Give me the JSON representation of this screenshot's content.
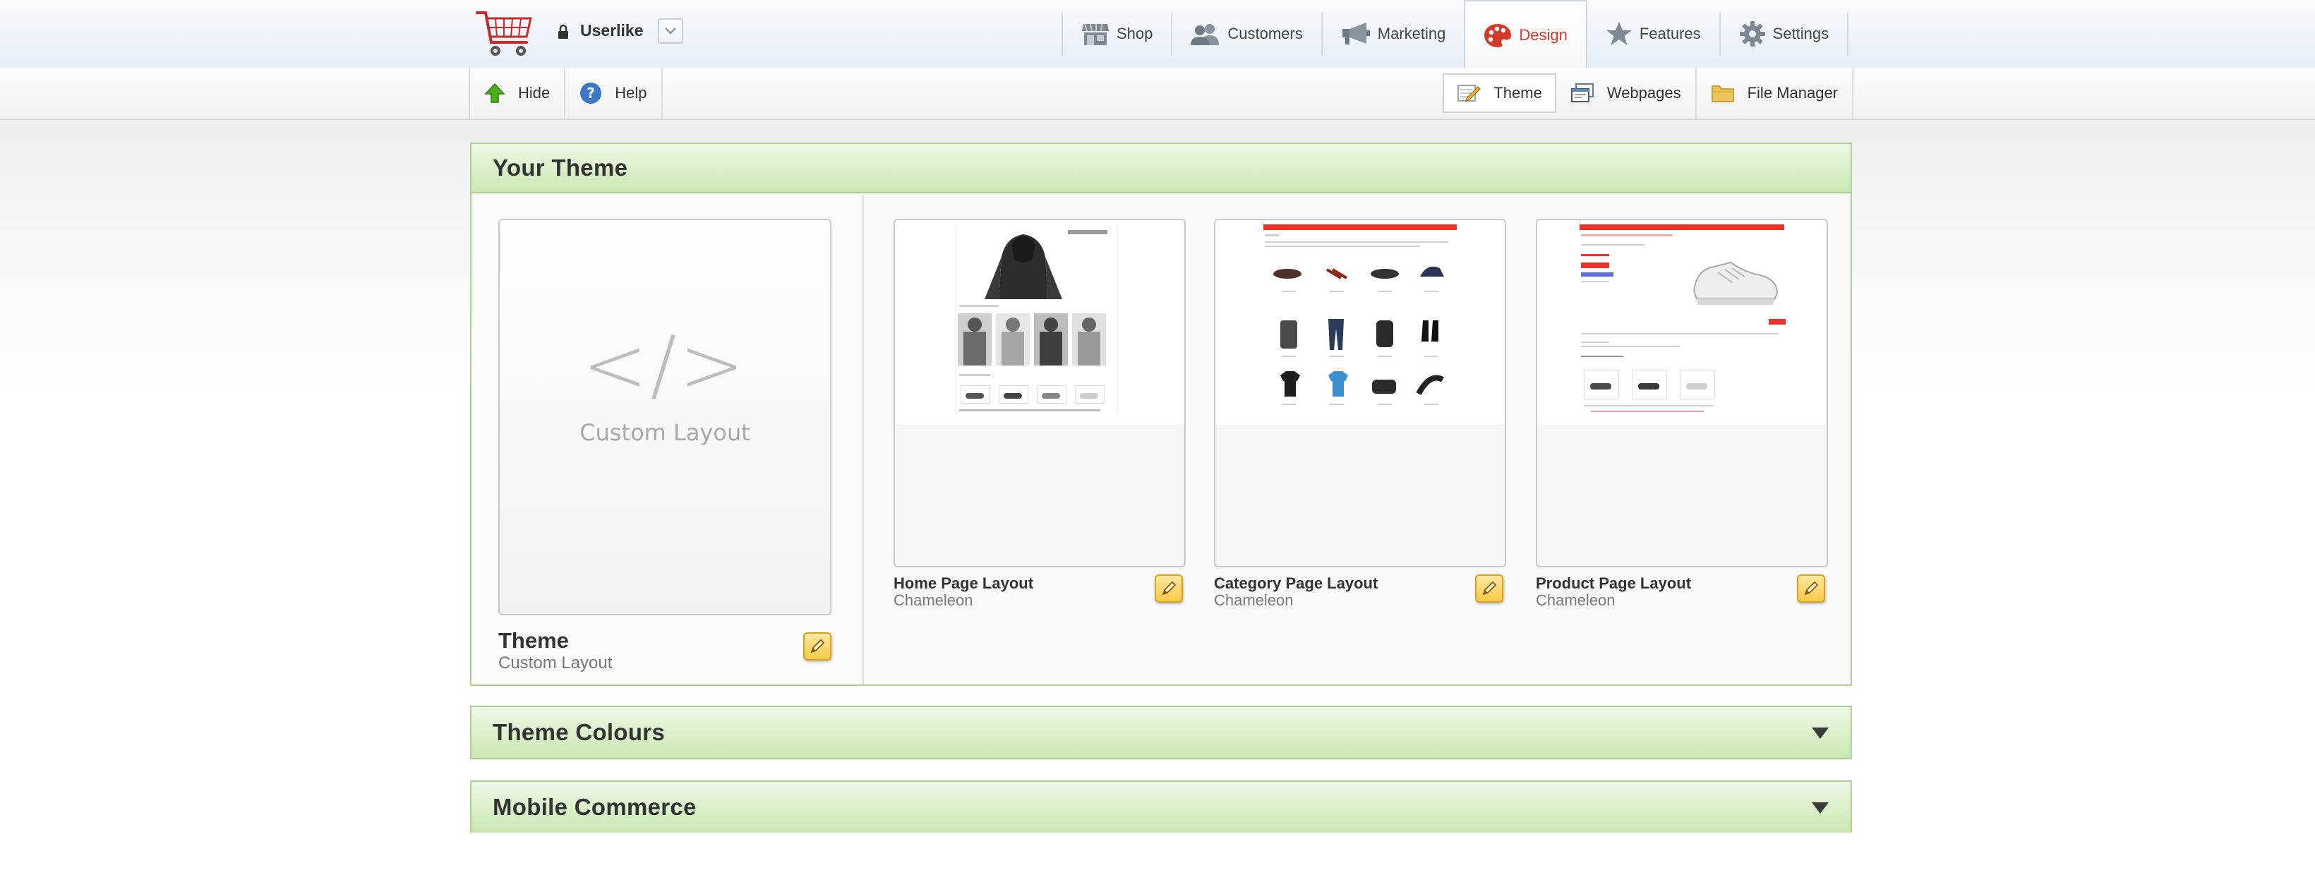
{
  "store": {
    "name": "Userlike"
  },
  "nav": {
    "items": [
      {
        "label": "Shop",
        "icon": "shop-icon",
        "active": false
      },
      {
        "label": "Customers",
        "icon": "customers-icon",
        "active": false
      },
      {
        "label": "Marketing",
        "icon": "megaphone-icon",
        "active": false
      },
      {
        "label": "Design",
        "icon": "palette-icon",
        "active": true
      },
      {
        "label": "Features",
        "icon": "star-icon",
        "active": false
      },
      {
        "label": "Settings",
        "icon": "gear-icon",
        "active": false
      }
    ]
  },
  "subnav": {
    "hide": "Hide",
    "help": "Help",
    "theme": "Theme",
    "webpages": "Webpages",
    "file_manager": "File Manager"
  },
  "your_theme": {
    "title": "Your Theme",
    "custom_card_text": "Custom Layout",
    "theme_name": "Theme",
    "theme_subtitle": "Custom Layout",
    "layouts": [
      {
        "name": "Home Page Layout",
        "theme": "Chameleon"
      },
      {
        "name": "Category Page Layout",
        "theme": "Chameleon"
      },
      {
        "name": "Product Page Layout",
        "theme": "Chameleon"
      }
    ]
  },
  "theme_colours": {
    "title": "Theme Colours"
  },
  "mobile_commerce": {
    "title": "Mobile Commerce"
  },
  "colors": {
    "accent_green": "#a9d18e",
    "active_red": "#d23a2a",
    "edit_yellow": "#f9c94a"
  }
}
